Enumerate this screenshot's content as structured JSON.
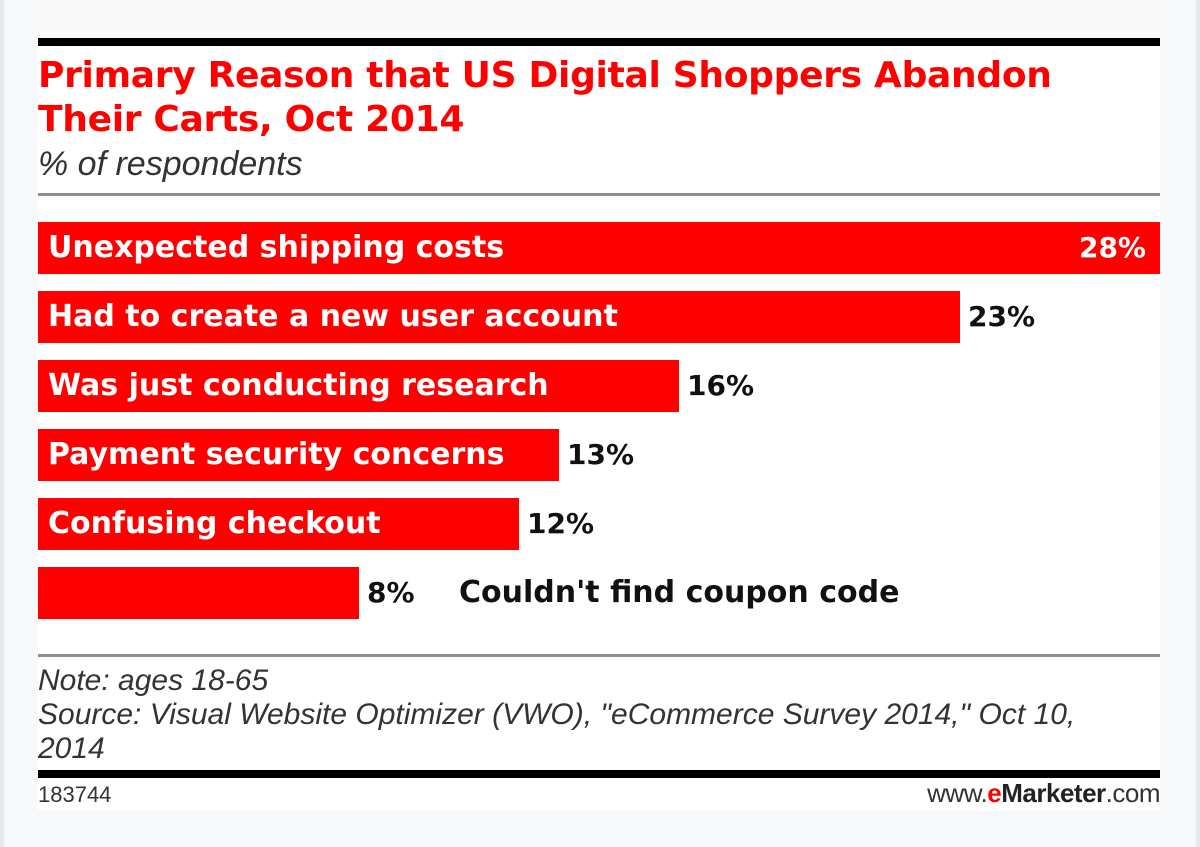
{
  "chart_data": {
    "type": "bar",
    "orientation": "horizontal",
    "title": "Primary Reason that US Digital Shoppers Abandon Their Carts, Oct 2014",
    "subtitle": "% of respondents",
    "categories": [
      "Unexpected shipping costs",
      "Had to create a new user account",
      "Was just conducting research",
      "Payment security concerns",
      "Confusing checkout",
      "Couldn't find coupon code"
    ],
    "values": [
      28,
      23,
      16,
      13,
      12,
      8
    ],
    "value_labels": [
      "28%",
      "23%",
      "16%",
      "13%",
      "12%",
      "8%"
    ],
    "xlabel": "",
    "ylabel": "",
    "xlim": [
      0,
      28
    ],
    "grid": false,
    "legend": "none",
    "bar_color": "#ff0000"
  },
  "header": {
    "title": "Primary Reason that US Digital Shoppers Abandon Their Carts, Oct 2014",
    "subtitle": "% of respondents"
  },
  "notes": {
    "note": "Note: ages 18-65",
    "source": "Source: Visual Website Optimizer (VWO), \"eCommerce Survey 2014,\" Oct 10, 2014"
  },
  "footer": {
    "chart_id": "183744",
    "brand_prefix": "www.",
    "brand_e": "e",
    "brand_name": "Marketer",
    "brand_suffix": ".com"
  },
  "colors": {
    "accent": "#ff0000",
    "text": "#333333"
  }
}
